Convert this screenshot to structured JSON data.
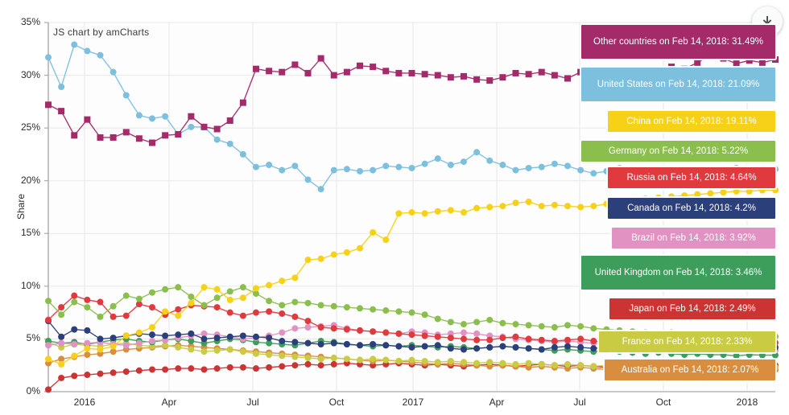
{
  "watermark": "JS chart by amCharts",
  "export": {
    "icon": "download-icon",
    "title": "Export"
  },
  "axes": {
    "y": {
      "title": "Share",
      "ticks": [
        "0%",
        "5%",
        "10%",
        "15%",
        "20%",
        "25%",
        "30%",
        "35%"
      ],
      "min": 0,
      "max": 35,
      "unit": "%"
    },
    "x": {
      "title": "",
      "ticks": [
        "2016",
        "Apr",
        "Jul",
        "Oct",
        "2017",
        "Apr",
        "Jul",
        "Oct",
        "2018"
      ]
    }
  },
  "colors": {
    "other_countries": "#a52a6a",
    "united_states": "#7cc0de",
    "china": "#f7d117",
    "germany": "#8bbf4d",
    "russia": "#e0393e",
    "canada": "#2b3f7a",
    "brazil": "#e292c2",
    "united_kingdom": "#3c9e5a",
    "japan": "#cc3333",
    "france": "#c9cc42",
    "australia": "#d98e3f",
    "extra_teal": "#1d6b63",
    "extra_olive": "#9c7b2e",
    "extra_darkred": "#8f2b2b",
    "grid": "#e8e8e8",
    "axis": "#b0a7ab",
    "text": "#2b2b2b",
    "background": "#ffffff"
  },
  "labels": [
    {
      "name": "other-countries",
      "text": "Other countries on Feb 14, 2018: 31.49%",
      "color": "#a52a6a",
      "value": 31.49,
      "series": "Other countries",
      "date": "Feb 14, 2018"
    },
    {
      "name": "united-states",
      "text": "United States on Feb 14, 2018: 21.09%",
      "color": "#7cc0de",
      "value": 21.09,
      "series": "United States",
      "date": "Feb 14, 2018"
    },
    {
      "name": "china",
      "text": "China on Feb 14, 2018: 19.11%",
      "color": "#f7d117",
      "value": 19.11,
      "series": "China",
      "date": "Feb 14, 2018"
    },
    {
      "name": "germany",
      "text": "Germany on Feb 14, 2018: 5.22%",
      "color": "#8bbf4d",
      "value": 5.22,
      "series": "Germany",
      "date": "Feb 14, 2018"
    },
    {
      "name": "russia",
      "text": "Russia on Feb 14, 2018: 4.64%",
      "color": "#e0393e",
      "value": 4.64,
      "series": "Russia",
      "date": "Feb 14, 2018"
    },
    {
      "name": "canada",
      "text": "Canada on Feb 14, 2018: 4.2%",
      "color": "#2b3f7a",
      "value": 4.2,
      "series": "Canada",
      "date": "Feb 14, 2018"
    },
    {
      "name": "brazil",
      "text": "Brazil on Feb 14, 2018: 3.92%",
      "color": "#e292c2",
      "value": 3.92,
      "series": "Brazil",
      "date": "Feb 14, 2018"
    },
    {
      "name": "united-kingdom",
      "text": "United Kingdom on Feb 14, 2018: 3.46%",
      "color": "#3c9e5a",
      "value": 3.46,
      "series": "United Kingdom",
      "date": "Feb 14, 2018"
    },
    {
      "name": "japan",
      "text": "Japan on Feb 14, 2018: 2.49%",
      "color": "#cc3333",
      "value": 2.49,
      "series": "Japan",
      "date": "Feb 14, 2018"
    },
    {
      "name": "france",
      "text": "France on Feb 14, 2018: 2.33%",
      "color": "#c9cc42",
      "value": 2.33,
      "series": "France",
      "date": "Feb 14, 2018"
    },
    {
      "name": "australia",
      "text": "Australia on Feb 14, 2018: 2.07%",
      "color": "#d98e3f",
      "value": 2.07,
      "series": "Australia",
      "date": "Feb 14, 2018"
    }
  ],
  "chart_data": {
    "type": "line",
    "title": "",
    "xlabel": "",
    "ylabel": "Share",
    "ylim": [
      0,
      35
    ],
    "grid": true,
    "legend_position": "right-end-labels",
    "x_tick_labels": [
      "2016",
      "Apr",
      "Jul",
      "Oct",
      "2017",
      "Apr",
      "Jul",
      "Oct",
      "2018"
    ],
    "x_index_range": [
      0,
      56
    ],
    "series": [
      {
        "name": "Other countries",
        "color": "#a52a6a",
        "marker": "square",
        "values": [
          27.2,
          26.6,
          24.3,
          25.8,
          24.1,
          24.1,
          24.6,
          24.0,
          23.6,
          24.3,
          24.4,
          26.1,
          25.1,
          24.9,
          25.7,
          27.4,
          30.6,
          30.4,
          30.3,
          31.0,
          30.2,
          31.6,
          30.0,
          30.3,
          30.9,
          30.8,
          30.4,
          30.2,
          30.2,
          30.1,
          30.0,
          29.8,
          29.9,
          29.6,
          29.5,
          29.8,
          30.2,
          30.1,
          30.3,
          30.0,
          29.7,
          30.3,
          30.4,
          30.2,
          29.9,
          29.6,
          29.5,
          30.2,
          30.8,
          30.6,
          31.2,
          31.9,
          31.6,
          31.1,
          31.4,
          31.2,
          31.49
        ]
      },
      {
        "name": "United States",
        "color": "#7cc0de",
        "marker": "circle",
        "values": [
          31.7,
          28.9,
          32.9,
          32.3,
          31.9,
          30.3,
          28.1,
          26.2,
          25.9,
          26.1,
          24.4,
          25.1,
          25.1,
          23.9,
          23.5,
          22.5,
          21.3,
          21.5,
          21.0,
          21.4,
          20.1,
          19.2,
          21.0,
          21.1,
          20.9,
          21.0,
          21.4,
          21.3,
          21.2,
          21.6,
          22.1,
          21.5,
          21.8,
          22.7,
          21.9,
          21.5,
          21.0,
          21.2,
          21.3,
          21.6,
          21.4,
          21.0,
          20.7,
          20.9,
          21.2,
          21.1,
          21.0,
          20.9,
          21.0,
          21.1,
          21.0,
          20.9,
          21.1,
          21.2,
          21.0,
          21.1,
          21.09
        ]
      },
      {
        "name": "China",
        "color": "#f7d117",
        "marker": "circle",
        "values": [
          3.1,
          2.6,
          3.4,
          4.1,
          4.0,
          4.3,
          5.3,
          5.6,
          6.1,
          7.6,
          7.2,
          8.4,
          9.9,
          9.7,
          8.7,
          8.9,
          9.8,
          10.1,
          10.5,
          10.8,
          12.5,
          12.6,
          13.0,
          13.2,
          13.6,
          15.1,
          14.4,
          16.9,
          17.0,
          16.9,
          17.1,
          17.2,
          17.0,
          17.4,
          17.5,
          17.6,
          17.9,
          18.0,
          17.6,
          17.7,
          17.6,
          17.5,
          17.6,
          17.8,
          18.0,
          18.2,
          18.3,
          18.4,
          18.5,
          18.6,
          18.7,
          18.8,
          18.9,
          19.0,
          19.0,
          19.1,
          19.11
        ]
      },
      {
        "name": "Germany",
        "color": "#8bbf4d",
        "marker": "circle",
        "values": [
          8.6,
          7.3,
          8.5,
          8.0,
          7.1,
          8.1,
          9.1,
          8.8,
          9.4,
          9.7,
          9.9,
          9.0,
          8.2,
          8.9,
          9.5,
          9.9,
          9.3,
          8.6,
          8.2,
          8.5,
          8.4,
          8.2,
          8.1,
          8.0,
          7.9,
          7.8,
          7.7,
          7.6,
          7.5,
          7.3,
          6.9,
          6.6,
          6.4,
          6.6,
          6.8,
          6.5,
          6.4,
          6.3,
          6.2,
          6.1,
          6.3,
          6.2,
          6.0,
          5.9,
          5.8,
          5.7,
          5.6,
          5.5,
          5.6,
          5.5,
          5.4,
          5.3,
          5.4,
          5.3,
          5.2,
          5.25,
          5.22
        ]
      },
      {
        "name": "Russia",
        "color": "#e0393e",
        "marker": "circle",
        "values": [
          6.8,
          8.0,
          9.1,
          8.7,
          8.5,
          7.1,
          7.2,
          8.3,
          8.0,
          7.3,
          7.8,
          8.2,
          8.1,
          8.0,
          7.5,
          7.2,
          7.5,
          7.6,
          7.4,
          7.1,
          6.7,
          6.1,
          6.0,
          5.9,
          5.8,
          5.7,
          5.6,
          5.5,
          5.4,
          5.3,
          5.2,
          5.1,
          5.0,
          4.9,
          4.9,
          5.1,
          5.2,
          5.0,
          4.9,
          4.8,
          4.9,
          5.0,
          4.8,
          4.7,
          4.6,
          4.7,
          4.8,
          4.7,
          4.6,
          4.6,
          4.7,
          4.6,
          4.6,
          4.7,
          4.6,
          4.65,
          4.64
        ]
      },
      {
        "name": "Canada",
        "color": "#2b3f7a",
        "marker": "circle",
        "values": [
          6.7,
          5.2,
          5.9,
          5.8,
          5.0,
          5.1,
          5.3,
          5.5,
          5.4,
          5.3,
          5.4,
          5.5,
          5.0,
          5.1,
          5.2,
          5.3,
          5.2,
          5.1,
          4.8,
          4.7,
          4.6,
          4.5,
          4.6,
          4.5,
          4.4,
          4.5,
          4.4,
          4.3,
          4.2,
          4.3,
          4.4,
          4.1,
          4.0,
          4.1,
          4.2,
          4.3,
          4.2,
          4.1,
          4.0,
          4.2,
          4.3,
          4.2,
          4.1,
          4.2,
          4.3,
          4.2,
          4.1,
          4.2,
          4.1,
          4.2,
          4.2,
          4.1,
          4.2,
          4.2,
          4.2,
          4.2,
          4.2
        ]
      },
      {
        "name": "Brazil",
        "color": "#e292c2",
        "marker": "circle",
        "values": [
          4.4,
          4.6,
          4.5,
          4.6,
          4.7,
          4.5,
          4.4,
          4.6,
          4.8,
          4.9,
          5.1,
          5.3,
          5.5,
          5.4,
          5.2,
          5.0,
          5.1,
          5.3,
          5.6,
          6.0,
          6.1,
          6.2,
          6.3,
          6.0,
          5.8,
          5.7,
          5.6,
          5.5,
          5.7,
          5.6,
          5.4,
          5.5,
          5.6,
          5.5,
          5.3,
          5.2,
          5.0,
          4.9,
          4.8,
          4.7,
          4.8,
          4.7,
          4.6,
          4.5,
          4.4,
          4.3,
          4.2,
          4.1,
          4.2,
          4.1,
          4.0,
          3.9,
          4.0,
          3.9,
          3.9,
          3.92,
          3.92
        ]
      },
      {
        "name": "United Kingdom",
        "color": "#3c9e5a",
        "marker": "circle",
        "values": [
          4.8,
          4.6,
          4.7,
          4.5,
          4.7,
          4.9,
          5.0,
          4.8,
          4.7,
          4.9,
          5.0,
          4.8,
          4.6,
          4.8,
          5.0,
          4.9,
          4.7,
          4.6,
          4.5,
          4.4,
          4.6,
          4.8,
          4.7,
          4.5,
          4.4,
          4.3,
          4.4,
          4.3,
          4.4,
          4.3,
          4.2,
          4.3,
          4.2,
          4.1,
          4.2,
          4.3,
          4.2,
          4.1,
          4.0,
          3.9,
          4.0,
          3.9,
          3.8,
          3.9,
          3.8,
          3.7,
          3.6,
          3.7,
          3.6,
          3.5,
          3.6,
          3.5,
          3.5,
          3.4,
          3.5,
          3.46,
          3.46
        ]
      },
      {
        "name": "Japan",
        "color": "#cc3333",
        "marker": "circle",
        "values": [
          0.2,
          1.3,
          1.5,
          1.6,
          1.7,
          1.8,
          1.9,
          2.0,
          2.1,
          2.1,
          2.2,
          2.2,
          2.1,
          2.2,
          2.3,
          2.3,
          2.2,
          2.3,
          2.4,
          2.5,
          2.6,
          2.5,
          2.6,
          2.7,
          2.6,
          2.5,
          2.6,
          2.7,
          2.6,
          2.5,
          2.6,
          2.5,
          2.4,
          2.5,
          2.6,
          2.5,
          2.4,
          2.5,
          2.6,
          2.5,
          2.4,
          2.5,
          2.4,
          2.3,
          2.4,
          2.5,
          2.4,
          2.3,
          2.4,
          2.5,
          2.4,
          2.5,
          2.4,
          2.5,
          2.5,
          2.49,
          2.49
        ]
      },
      {
        "name": "France",
        "color": "#c9cc42",
        "marker": "circle",
        "values": [
          4.7,
          4.2,
          4.5,
          4.4,
          4.3,
          4.5,
          4.6,
          4.4,
          4.3,
          4.4,
          4.2,
          4.0,
          3.8,
          3.9,
          4.0,
          3.8,
          3.6,
          3.5,
          3.4,
          3.3,
          3.2,
          3.1,
          3.2,
          3.1,
          3.0,
          3.1,
          3.0,
          2.9,
          3.0,
          2.9,
          2.8,
          2.9,
          2.8,
          2.7,
          2.8,
          2.7,
          2.6,
          2.7,
          2.6,
          2.5,
          2.6,
          2.5,
          2.4,
          2.5,
          2.4,
          2.3,
          2.4,
          2.3,
          2.4,
          2.3,
          2.3,
          2.4,
          2.3,
          2.3,
          2.3,
          2.33,
          2.33
        ]
      },
      {
        "name": "Australia",
        "color": "#d98e3f",
        "marker": "circle",
        "values": [
          2.7,
          3.1,
          3.3,
          3.5,
          3.6,
          3.8,
          4.0,
          4.1,
          4.2,
          4.3,
          4.4,
          4.3,
          4.2,
          4.1,
          4.0,
          3.9,
          3.8,
          3.7,
          3.6,
          3.5,
          3.4,
          3.3,
          3.2,
          3.1,
          3.0,
          2.9,
          3.0,
          2.9,
          2.8,
          2.7,
          2.6,
          2.7,
          2.6,
          2.5,
          2.4,
          2.5,
          2.4,
          2.3,
          2.4,
          2.3,
          2.2,
          2.3,
          2.2,
          2.1,
          2.2,
          2.1,
          2.0,
          2.1,
          2.0,
          2.1,
          2.0,
          2.1,
          2.0,
          2.1,
          2.07,
          2.07,
          2.07
        ]
      }
    ]
  }
}
